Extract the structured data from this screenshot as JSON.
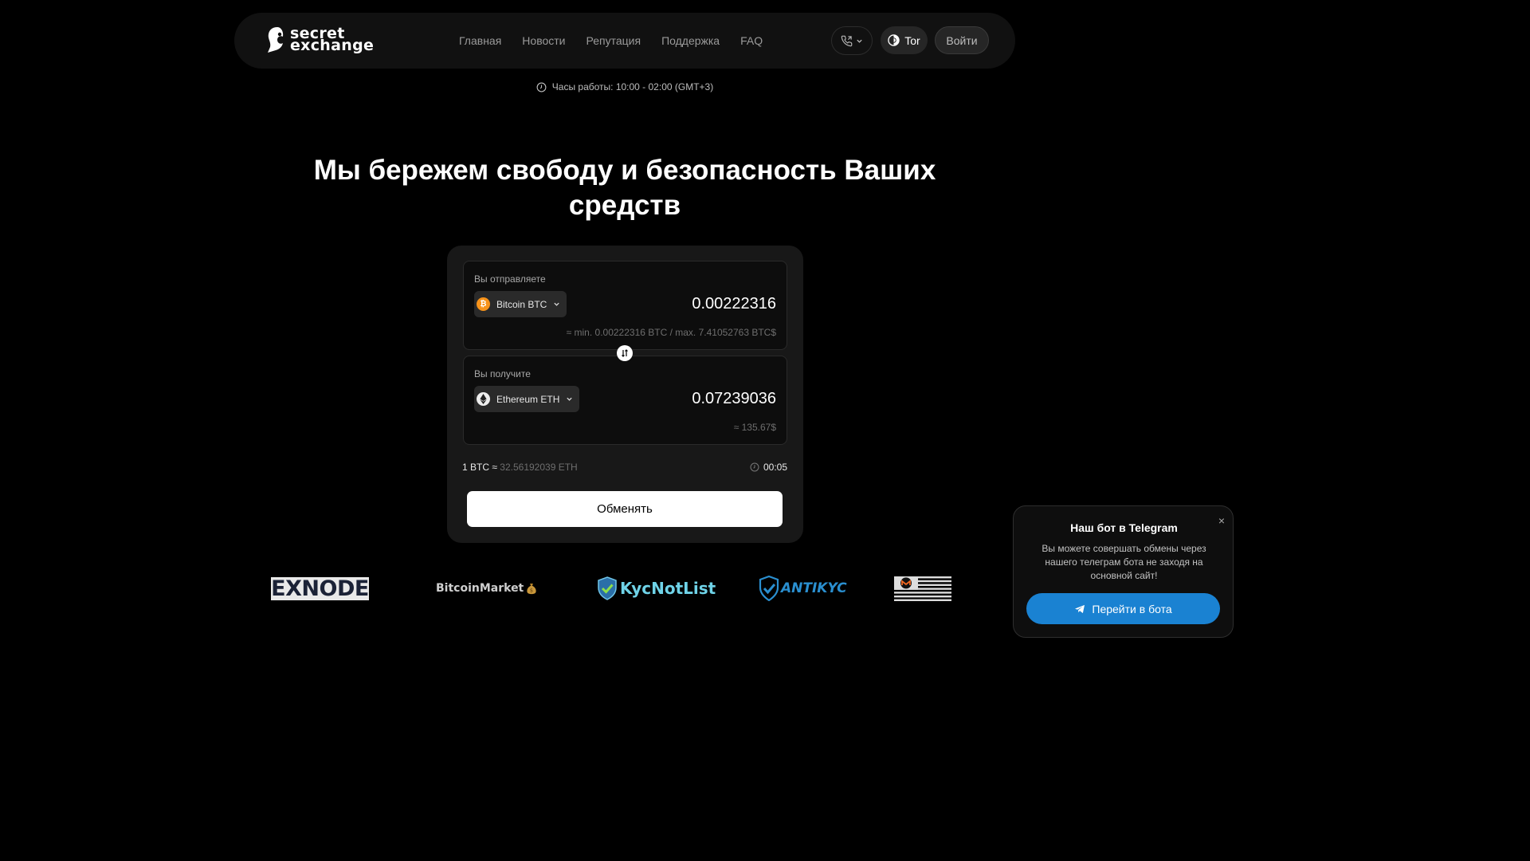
{
  "header": {
    "logo_line1": "secret",
    "logo_line2": "exchange",
    "nav": [
      "Главная",
      "Новости",
      "Репутация",
      "Поддержка",
      "FAQ"
    ],
    "tor_label": "Tor",
    "login_label": "Войти"
  },
  "hours_text": "Часы работы: 10:00 - 02:00 (GMT+3)",
  "hero_title": "Мы бережем свободу и безопасность Ваших средств",
  "exchange": {
    "send": {
      "label": "Вы отправляете",
      "coin": "Bitcoin BTC",
      "amount": "0.00222316",
      "limits": "≈ min. 0.00222316 BTC / max. 7.41052763 BTC$"
    },
    "receive": {
      "label": "Вы получите",
      "coin": "Ethereum ETH",
      "amount": "0.07239036",
      "usd": "≈ 135.67$"
    },
    "rate_left": "1 BTC",
    "rate_sep": "≈",
    "rate_right": "32.56192039 ETH",
    "timer": "00:05",
    "button": "Обменять"
  },
  "partners": {
    "exnode": "EXNODE",
    "bitcoinmarket": "BitcoinMarket",
    "kycnotlist": "KycNotList",
    "antikyc": "ANTIKYC"
  },
  "telegram": {
    "close": "×",
    "title": "Наш бот в Telegram",
    "text": "Вы можете совершать обмены через нашего телеграм бота не заходя на основной сайт!",
    "button": "Перейти в бота"
  },
  "colors": {
    "background": "#000000",
    "card": "#181818",
    "telegram_button": "#1a82d2",
    "btc": "#f7931a"
  }
}
